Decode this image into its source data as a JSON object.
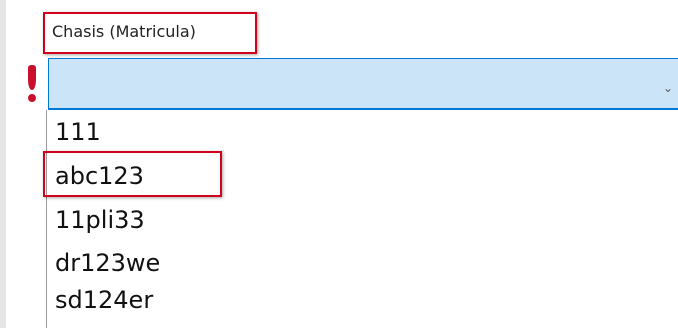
{
  "field": {
    "label": "Chasis (Matricula)",
    "value": "",
    "validation": "error",
    "error_icon": "exclamation-icon",
    "chevron": "⌄",
    "chevron_icon": "chevron-down-icon"
  },
  "dropdown": {
    "options": [
      "111",
      "abc123",
      "11pli33",
      "dr123we",
      "sd124er"
    ],
    "highlighted": "abc123"
  },
  "colors": {
    "annotation_red": "#d0021b",
    "error_red": "#c8102e",
    "combo_background": "#cce4f7",
    "combo_border": "#0078d7"
  }
}
